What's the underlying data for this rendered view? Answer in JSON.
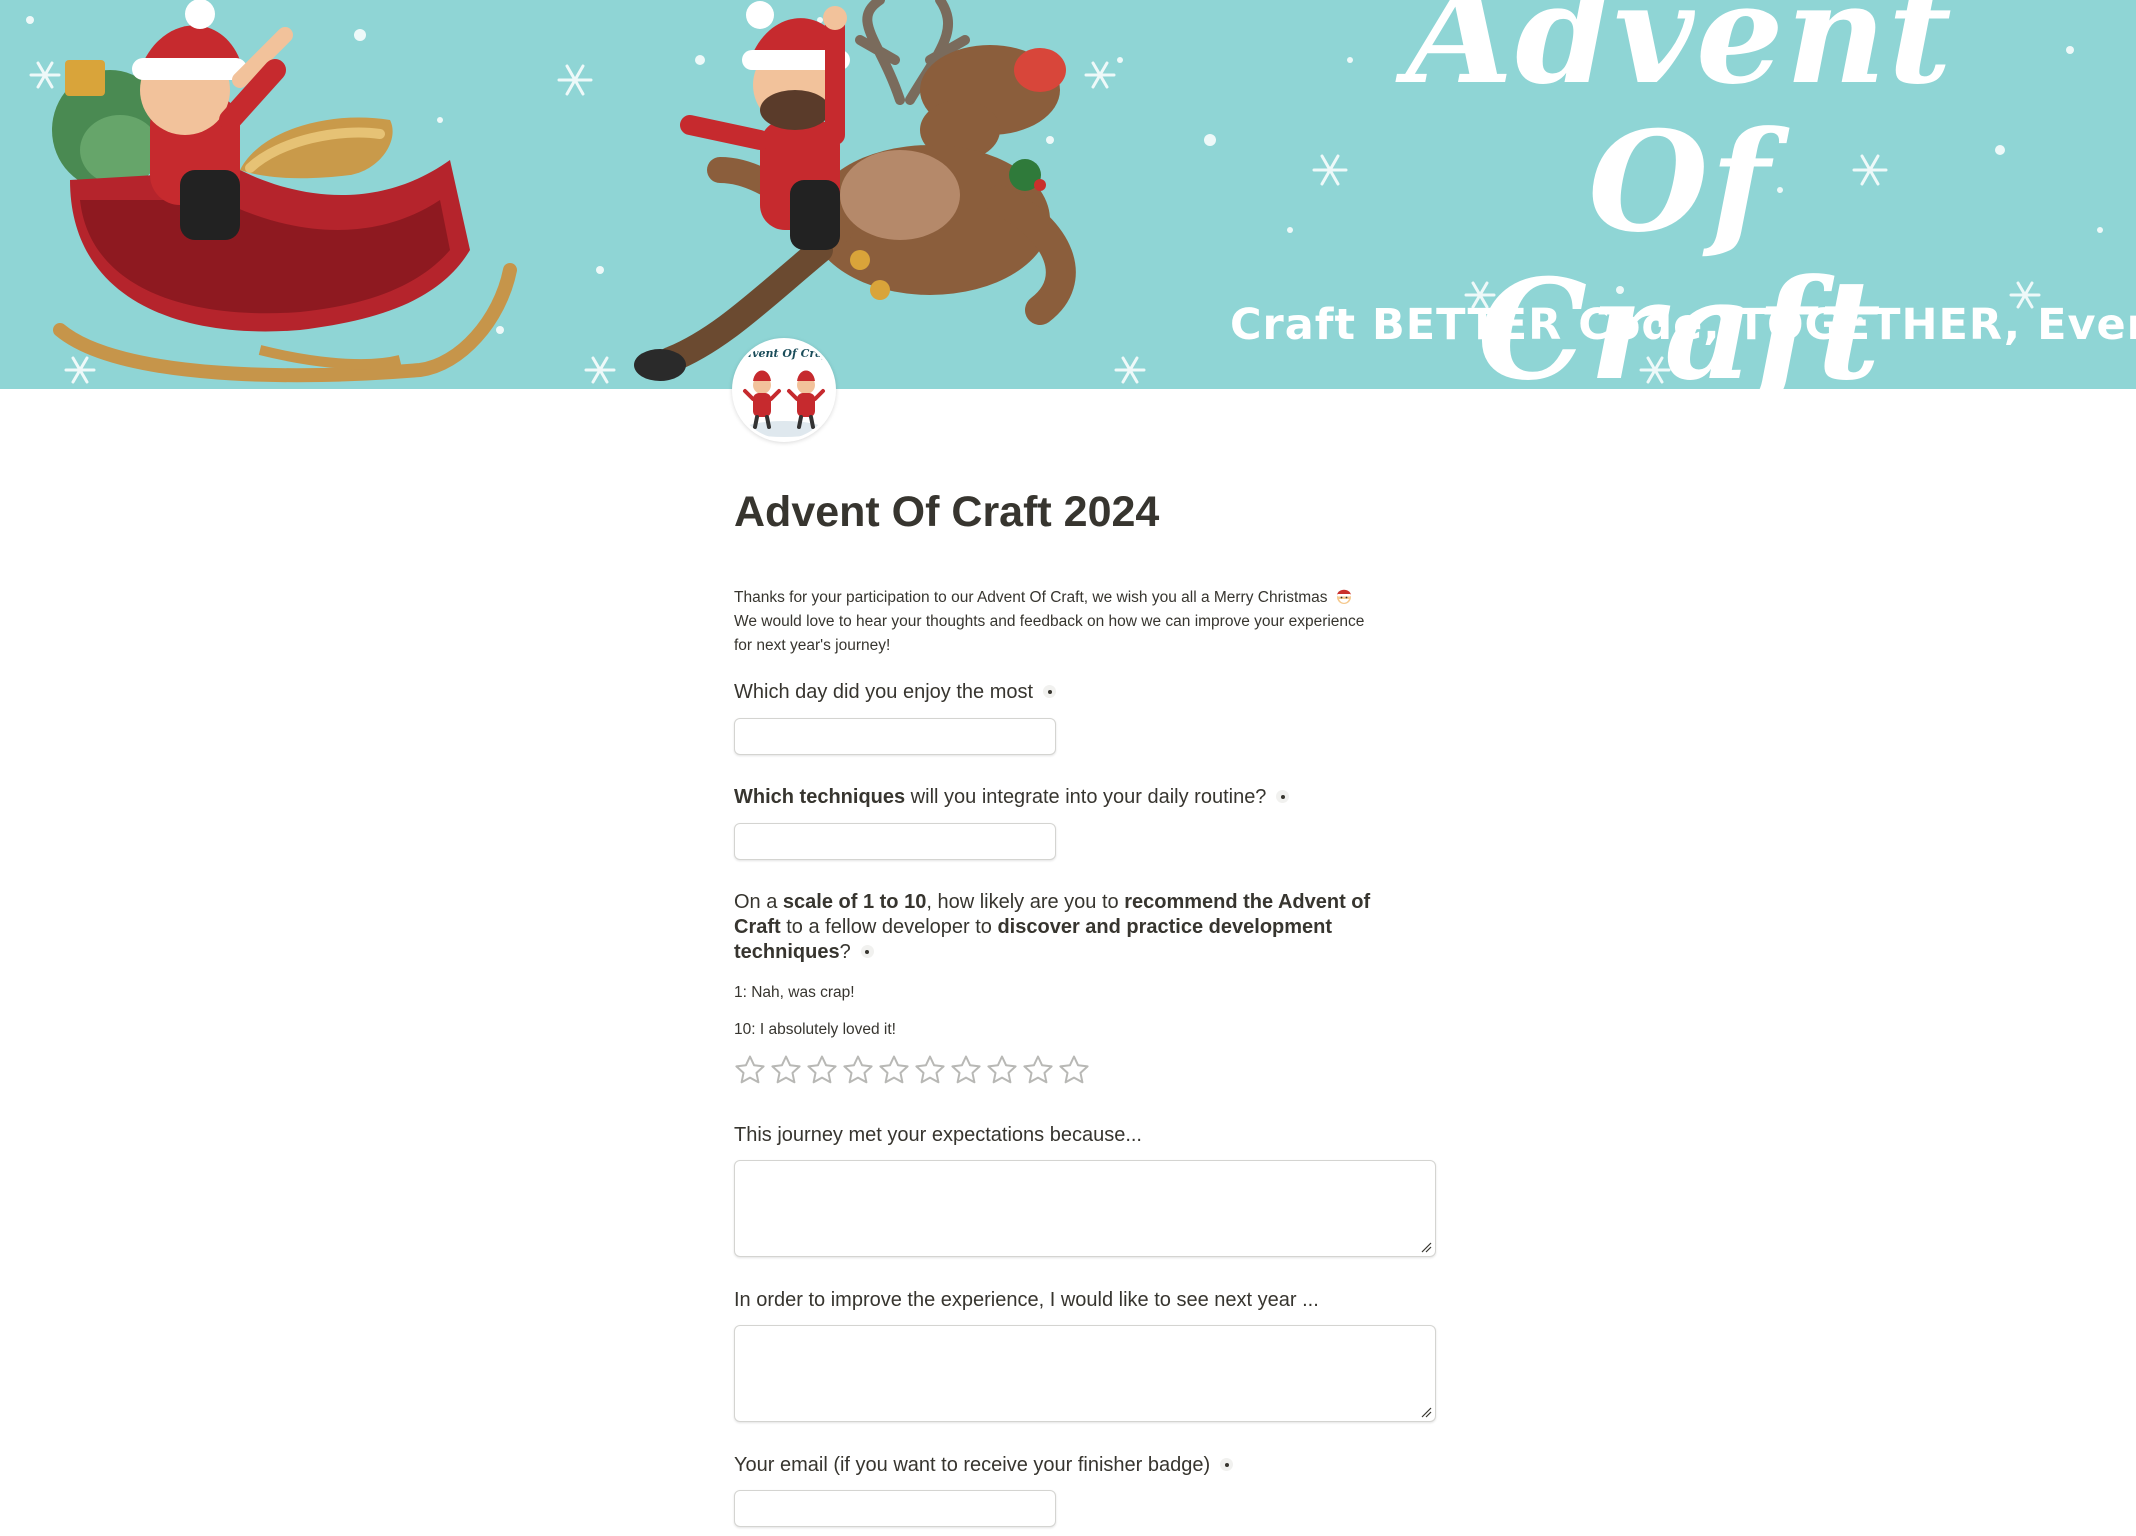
{
  "banner": {
    "title_line1": "Advent Of",
    "title_line2": "Craft",
    "tagline": "Craft BETTER Code, TOGETHER, Every Day.",
    "background_color": "#8fd5d5"
  },
  "page_icon": {
    "label": "Advent Of Craft",
    "icon": "avatar-icon"
  },
  "page_title": "Advent Of Craft 2024",
  "intro": {
    "line1": "Thanks for your participation to our Advent Of Craft, we wish you all a Merry Christmas",
    "line1_emoji": "santa-face-icon",
    "line2": "We would love to hear your thoughts and feedback on how we can improve your experience",
    "line3": "for next year's journey!"
  },
  "questions": {
    "q1": {
      "label": "Which day did you enjoy the most",
      "value": "",
      "required": true
    },
    "q2": {
      "label_bold": "Which techniques",
      "label_rest": " will you integrate into your daily routine?",
      "value": "",
      "required": true
    },
    "q3": {
      "line1_a": "On a ",
      "line1_b": "scale of 1 to 10",
      "line1_c": ", how likely are you to ",
      "line1_d": "recommend the Advent of",
      "line2_a": "Craft",
      "line2_b": " to a fellow developer to ",
      "line2_c": "discover and practice development",
      "line3_a": "techniques",
      "line3_b": "?",
      "hint_low": "1: Nah, was crap!",
      "hint_high": "10: I absolutely loved it!",
      "rating": 0,
      "max_rating": 10,
      "required": true
    },
    "q4": {
      "label": "This journey met your expectations because...",
      "value": ""
    },
    "q5": {
      "label": "In order to improve the experience, I would like to see next year ...",
      "value": ""
    },
    "q6": {
      "label": "Your email (if you want to receive your finisher badge)",
      "value": "",
      "required": true
    }
  },
  "colors": {
    "text": "#37352f",
    "star_outline": "#b8b8b5",
    "field_border": "#d4d4d1"
  }
}
